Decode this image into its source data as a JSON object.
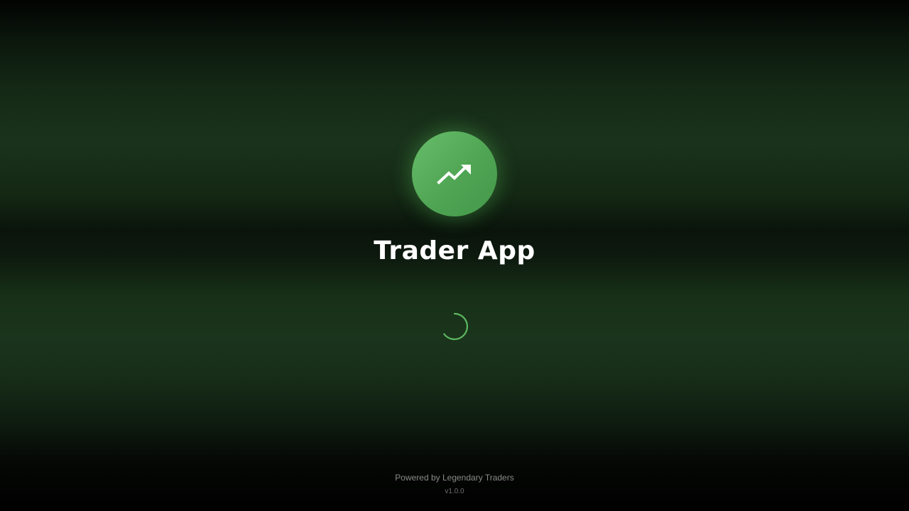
{
  "app": {
    "title": "Trader App",
    "logo_icon": "trending-up-icon",
    "accent_color": "#4caf50"
  },
  "loading": {
    "indicator": "spinner-icon"
  },
  "footer": {
    "powered_by": "Powered by Legendary Traders",
    "version": "v1.0.0"
  }
}
